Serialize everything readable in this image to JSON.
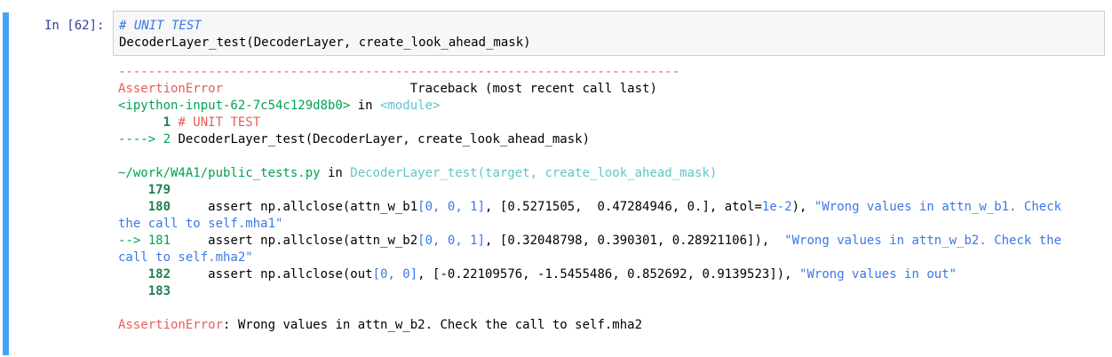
{
  "cell": {
    "prompt": "In [62]:",
    "code": {
      "line1": "# UNIT TEST",
      "line2": "DecoderLayer_test(DecoderLayer, create_look_ahead_mask)"
    }
  },
  "traceback": {
    "separator": "---------------------------------------------------------------------------",
    "error_name": "AssertionError",
    "header_right": "Traceback (most recent call last)",
    "frame1": {
      "file": "<ipython-input-62-7c54c129d8b0>",
      "in_text": " in ",
      "func": "<module>",
      "l1_no": "      1 ",
      "l1_code": "# UNIT TEST",
      "l2_arrow": "----> 2 ",
      "l2_code": "DecoderLayer_test(DecoderLayer, create_look_ahead_mask)"
    },
    "frame2": {
      "file": "~/work/W4A1/public_tests.py",
      "in_text": " in ",
      "func": "DecoderLayer_test(target, create_look_ahead_mask)",
      "l179": "    179",
      "l180": "    180",
      "l180_code_a": "     assert np.allclose(attn_w_b1",
      "l180_idx": "[0, 0, 1]",
      "l180_code_b": ", [0.5271505,  0.47284946, 0.], atol=",
      "l180_atol": "1e-2",
      "l180_code_c": "), ",
      "l180_str": "\"Wrong values in attn_w_b1. Check",
      "l180_cont": "the call to self.mha1\"",
      "l181_arrow": "--> 181",
      "l181_code_a": "     assert np.allclose(attn_w_b2",
      "l181_idx": "[0, 0, 1]",
      "l181_code_b": ", [0.32048798, 0.390301, 0.28921106]),  ",
      "l181_str": "\"Wrong values in attn_w_b2. Check the",
      "l181_cont": "call to self.mha2\"",
      "l182": "    182",
      "l182_code_a": "     assert np.allclose(out",
      "l182_idx": "[0, 0]",
      "l182_code_b": ", [-0.22109576, -1.5455486, 0.852692, 0.9139523]), ",
      "l182_str": "\"Wrong values in out\"",
      "l183": "    183"
    },
    "final_error_name": "AssertionError",
    "final_message": ": Wrong values in attn_w_b2. Check the call to self.mha2"
  }
}
